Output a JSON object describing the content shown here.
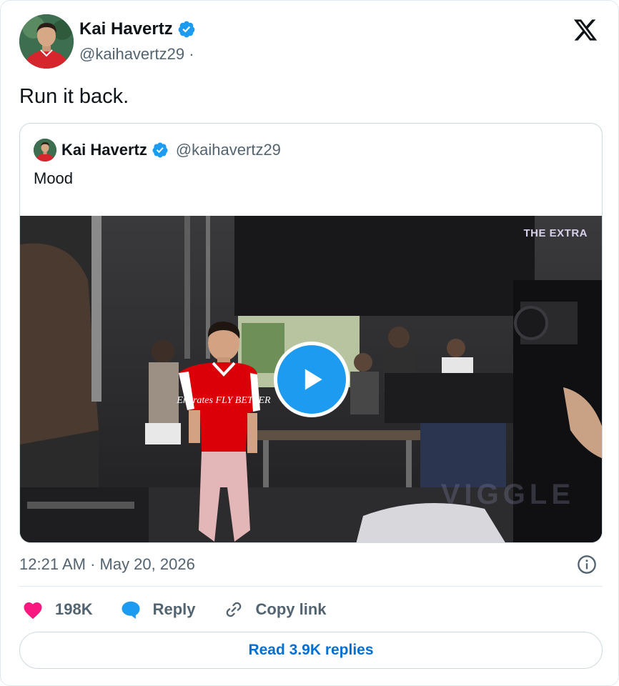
{
  "author": {
    "name": "Kai Havertz",
    "handle": "@kaihavertz29",
    "handle_separator": "·"
  },
  "tweet": {
    "text": "Run it back."
  },
  "quoted_tweet": {
    "author_name": "Kai Havertz",
    "author_handle": "@kaihavertz29",
    "text": "Mood",
    "media": {
      "type": "video",
      "watermark_top": "THE EXTRA",
      "watermark_bottom": "VIGGLE",
      "jersey_text": "Emirates FLY BETTER"
    }
  },
  "meta": {
    "timestamp": "12:21 AM · May 20, 2026"
  },
  "actions": {
    "likes_count": "198K",
    "reply_label": "Reply",
    "copy_link_label": "Copy link"
  },
  "read_replies": {
    "label": "Read 3.9K replies"
  },
  "colors": {
    "accent_blue": "#1d9bf0",
    "like_pink": "#f91880",
    "link_blue": "#006fd6",
    "secondary_text": "#536471",
    "jersey_red": "#db0007"
  },
  "icons": {
    "verified": "verified-badge-icon",
    "platform": "x-logo-icon",
    "info": "info-icon",
    "like": "heart-icon",
    "reply": "speech-bubble-icon",
    "link": "link-icon",
    "play": "play-icon"
  }
}
